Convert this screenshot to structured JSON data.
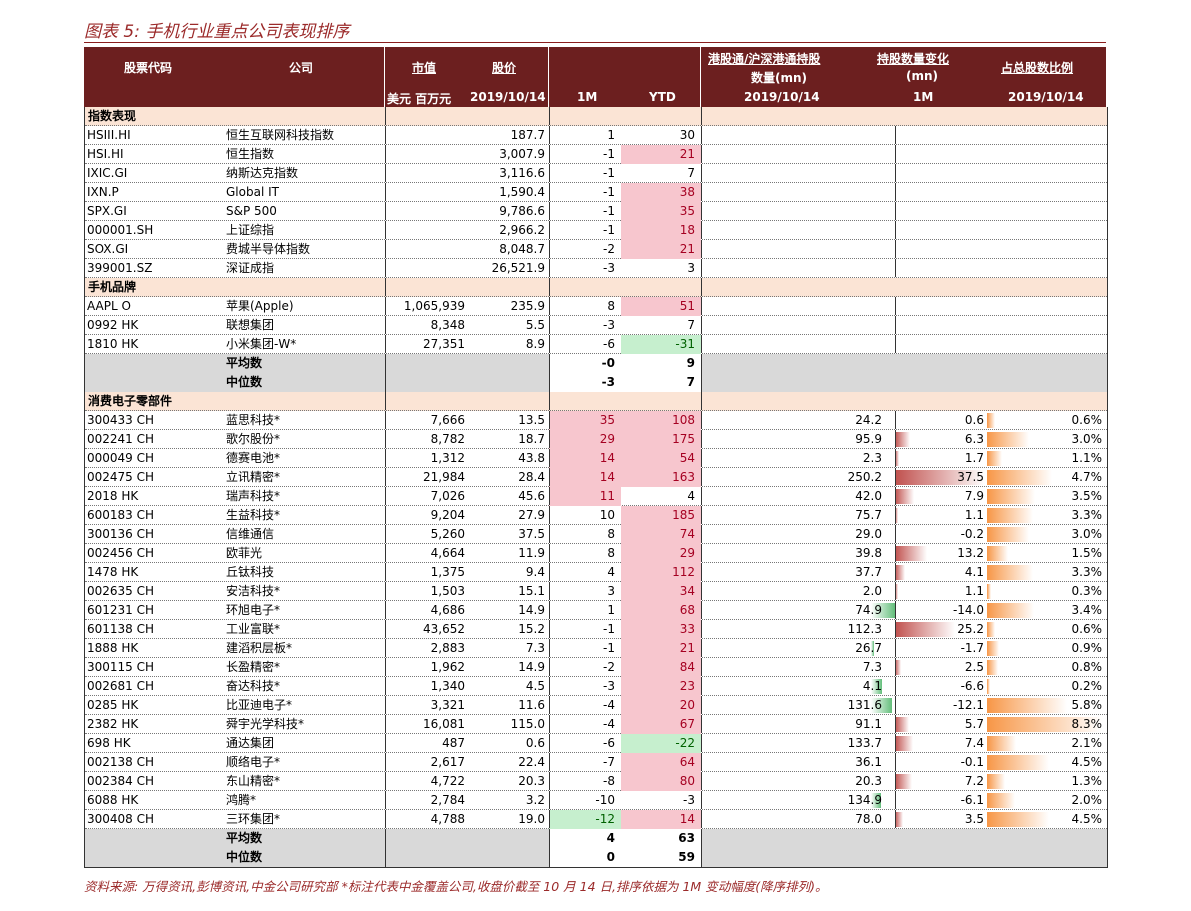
{
  "title": "图表 5:  手机行业重点公司表现排序",
  "header": {
    "code": "股票代码",
    "company": "公司",
    "mktcap": "市值",
    "price": "股价",
    "hk_hold_line1": "港股通/沪深港通持股",
    "hk_hold_line2": "数量(mn)",
    "hold_chg_line1": "持股数量变化",
    "hold_chg_line2": "(mn)",
    "pct": "占总股数比例",
    "sub_mktcap": "美元 百万元",
    "sub_date": "2019/10/14",
    "sub_1m": "1M",
    "sub_ytd": "YTD",
    "sub_date2": "2019/10/14",
    "sub_1m2": "1M",
    "sub_date3": "2019/10/14"
  },
  "colors": {
    "red_bg": "#f7c6ce",
    "green_bg": "#c6efce",
    "header_bg": "#6c1f1f"
  },
  "sections": [
    {
      "name": "指数表现",
      "rows": [
        {
          "code": "HSIII.HI",
          "name": "恒生互联网科技指数",
          "cap": "",
          "price": "187.7",
          "m1": "1",
          "ytd": "30",
          "m1c": "",
          "ytdc": ""
        },
        {
          "code": "HSI.HI",
          "name": "恒生指数",
          "cap": "",
          "price": "3,007.9",
          "m1": "-1",
          "ytd": "21",
          "m1c": "",
          "ytdc": "red"
        },
        {
          "code": "IXIC.GI",
          "name": "纳斯达克指数",
          "cap": "",
          "price": "3,116.6",
          "m1": "-1",
          "ytd": "7",
          "m1c": "",
          "ytdc": ""
        },
        {
          "code": "IXN.P",
          "name": "Global IT",
          "cap": "",
          "price": "1,590.4",
          "m1": "-1",
          "ytd": "38",
          "m1c": "",
          "ytdc": "red"
        },
        {
          "code": "SPX.GI",
          "name": "S&P 500",
          "cap": "",
          "price": "9,786.6",
          "m1": "-1",
          "ytd": "35",
          "m1c": "",
          "ytdc": "red"
        },
        {
          "code": "000001.SH",
          "name": "上证综指",
          "cap": "",
          "price": "2,966.2",
          "m1": "-1",
          "ytd": "18",
          "m1c": "",
          "ytdc": "red"
        },
        {
          "code": "SOX.GI",
          "name": "费城半导体指数",
          "cap": "",
          "price": "8,048.7",
          "m1": "-2",
          "ytd": "21",
          "m1c": "",
          "ytdc": "red"
        },
        {
          "code": "399001.SZ",
          "name": "深证成指",
          "cap": "",
          "price": "26,521.9",
          "m1": "-3",
          "ytd": "3",
          "m1c": "",
          "ytdc": ""
        }
      ]
    },
    {
      "name": "手机品牌",
      "rows": [
        {
          "code": "AAPL O",
          "name": "苹果(Apple)",
          "cap": "1,065,939",
          "price": "235.9",
          "m1": "8",
          "ytd": "51",
          "m1c": "",
          "ytdc": "red"
        },
        {
          "code": "0992 HK",
          "name": "联想集团",
          "cap": "8,348",
          "price": "5.5",
          "m1": "-3",
          "ytd": "7",
          "m1c": "",
          "ytdc": ""
        },
        {
          "code": "1810 HK",
          "name": "小米集团-W*",
          "cap": "27,351",
          "price": "8.9",
          "m1": "-6",
          "ytd": "-31",
          "m1c": "",
          "ytdc": "grn"
        }
      ],
      "avg": {
        "label1": "平均数",
        "m1a": "-0",
        "ytda": "9",
        "label2": "中位数",
        "m1b": "-3",
        "ytdb": "7"
      }
    },
    {
      "name": "消费电子零部件",
      "rows": [
        {
          "code": "300433 CH",
          "name": "蓝思科技*",
          "cap": "7,666",
          "price": "13.5",
          "m1": "35",
          "ytd": "108",
          "m1c": "red",
          "ytdc": "red",
          "hold": "24.2",
          "chg": "0.6",
          "pct": "0.6%"
        },
        {
          "code": "002241 CH",
          "name": "歌尔股份*",
          "cap": "8,782",
          "price": "18.7",
          "m1": "29",
          "ytd": "175",
          "m1c": "red",
          "ytdc": "red",
          "hold": "95.9",
          "chg": "6.3",
          "pct": "3.0%"
        },
        {
          "code": "000049 CH",
          "name": "德赛电池*",
          "cap": "1,312",
          "price": "43.8",
          "m1": "14",
          "ytd": "54",
          "m1c": "red",
          "ytdc": "red",
          "hold": "2.3",
          "chg": "1.7",
          "pct": "1.1%"
        },
        {
          "code": "002475 CH",
          "name": "立讯精密*",
          "cap": "21,984",
          "price": "28.4",
          "m1": "14",
          "ytd": "163",
          "m1c": "red",
          "ytdc": "red",
          "hold": "250.2",
          "chg": "37.5",
          "pct": "4.7%"
        },
        {
          "code": "2018 HK",
          "name": "瑞声科技*",
          "cap": "7,026",
          "price": "45.6",
          "m1": "11",
          "ytd": "4",
          "m1c": "red",
          "ytdc": "",
          "hold": "42.0",
          "chg": "7.9",
          "pct": "3.5%"
        },
        {
          "code": "600183 CH",
          "name": "生益科技*",
          "cap": "9,204",
          "price": "27.9",
          "m1": "10",
          "ytd": "185",
          "m1c": "",
          "ytdc": "red",
          "hold": "75.7",
          "chg": "1.1",
          "pct": "3.3%"
        },
        {
          "code": "300136 CH",
          "name": "信维通信",
          "cap": "5,260",
          "price": "37.5",
          "m1": "8",
          "ytd": "74",
          "m1c": "",
          "ytdc": "red",
          "hold": "29.0",
          "chg": "-0.2",
          "pct": "3.0%"
        },
        {
          "code": "002456 CH",
          "name": "欧菲光",
          "cap": "4,664",
          "price": "11.9",
          "m1": "8",
          "ytd": "29",
          "m1c": "",
          "ytdc": "red",
          "hold": "39.8",
          "chg": "13.2",
          "pct": "1.5%"
        },
        {
          "code": "1478 HK",
          "name": "丘钛科技",
          "cap": "1,375",
          "price": "9.4",
          "m1": "4",
          "ytd": "112",
          "m1c": "",
          "ytdc": "red",
          "hold": "37.7",
          "chg": "4.1",
          "pct": "3.3%"
        },
        {
          "code": "002635 CH",
          "name": "安洁科技*",
          "cap": "1,503",
          "price": "15.1",
          "m1": "3",
          "ytd": "34",
          "m1c": "",
          "ytdc": "red",
          "hold": "2.0",
          "chg": "1.1",
          "pct": "0.3%"
        },
        {
          "code": "601231 CH",
          "name": "环旭电子*",
          "cap": "4,686",
          "price": "14.9",
          "m1": "1",
          "ytd": "68",
          "m1c": "",
          "ytdc": "red",
          "hold": "74.9",
          "chg": "-14.0",
          "pct": "3.4%"
        },
        {
          "code": "601138 CH",
          "name": "工业富联*",
          "cap": "43,652",
          "price": "15.2",
          "m1": "-1",
          "ytd": "33",
          "m1c": "",
          "ytdc": "red",
          "hold": "112.3",
          "chg": "25.2",
          "pct": "0.6%"
        },
        {
          "code": "1888 HK",
          "name": "建滔积层板*",
          "cap": "2,883",
          "price": "7.3",
          "m1": "-1",
          "ytd": "21",
          "m1c": "",
          "ytdc": "red",
          "hold": "26.7",
          "chg": "-1.7",
          "pct": "0.9%"
        },
        {
          "code": "300115 CH",
          "name": "长盈精密*",
          "cap": "1,962",
          "price": "14.9",
          "m1": "-2",
          "ytd": "84",
          "m1c": "",
          "ytdc": "red",
          "hold": "7.3",
          "chg": "2.5",
          "pct": "0.8%"
        },
        {
          "code": "002681 CH",
          "name": "奋达科技*",
          "cap": "1,340",
          "price": "4.5",
          "m1": "-3",
          "ytd": "23",
          "m1c": "",
          "ytdc": "red",
          "hold": "4.1",
          "chg": "-6.6",
          "pct": "0.2%"
        },
        {
          "code": "0285 HK",
          "name": "比亚迪电子*",
          "cap": "3,321",
          "price": "11.6",
          "m1": "-4",
          "ytd": "20",
          "m1c": "",
          "ytdc": "red",
          "hold": "131.6",
          "chg": "-12.1",
          "pct": "5.8%"
        },
        {
          "code": "2382 HK",
          "name": "舜宇光学科技*",
          "cap": "16,081",
          "price": "115.0",
          "m1": "-4",
          "ytd": "67",
          "m1c": "",
          "ytdc": "red",
          "hold": "91.1",
          "chg": "5.7",
          "pct": "8.3%"
        },
        {
          "code": "698 HK",
          "name": "通达集团",
          "cap": "487",
          "price": "0.6",
          "m1": "-6",
          "ytd": "-22",
          "m1c": "",
          "ytdc": "grn",
          "hold": "133.7",
          "chg": "7.4",
          "pct": "2.1%"
        },
        {
          "code": "002138 CH",
          "name": "顺络电子*",
          "cap": "2,617",
          "price": "22.4",
          "m1": "-7",
          "ytd": "64",
          "m1c": "",
          "ytdc": "red",
          "hold": "36.1",
          "chg": "-0.1",
          "pct": "4.5%"
        },
        {
          "code": "002384 CH",
          "name": "东山精密*",
          "cap": "4,722",
          "price": "20.3",
          "m1": "-8",
          "ytd": "80",
          "m1c": "",
          "ytdc": "red",
          "hold": "20.3",
          "chg": "7.2",
          "pct": "1.3%"
        },
        {
          "code": "6088 HK",
          "name": "鸿腾*",
          "cap": "2,784",
          "price": "3.2",
          "m1": "-10",
          "ytd": "-3",
          "m1c": "",
          "ytdc": "",
          "hold": "134.9",
          "chg": "-6.1",
          "pct": "2.0%"
        },
        {
          "code": "300408 CH",
          "name": "三环集团*",
          "cap": "4,788",
          "price": "19.0",
          "m1": "-12",
          "ytd": "14",
          "m1c": "grn",
          "ytdc": "red",
          "hold": "78.0",
          "chg": "3.5",
          "pct": "4.5%"
        }
      ],
      "avg": {
        "label1": "平均数",
        "m1a": "4",
        "ytda": "63",
        "label2": "中位数",
        "m1b": "0",
        "ytdb": "59"
      }
    }
  ],
  "source": "资料来源:  万得资讯,彭博资讯,中金公司研究部   *标注代表中金覆盖公司,收盘价截至 10 月 14 日,排序依据为 1M 变动幅度(降序排列)。"
}
